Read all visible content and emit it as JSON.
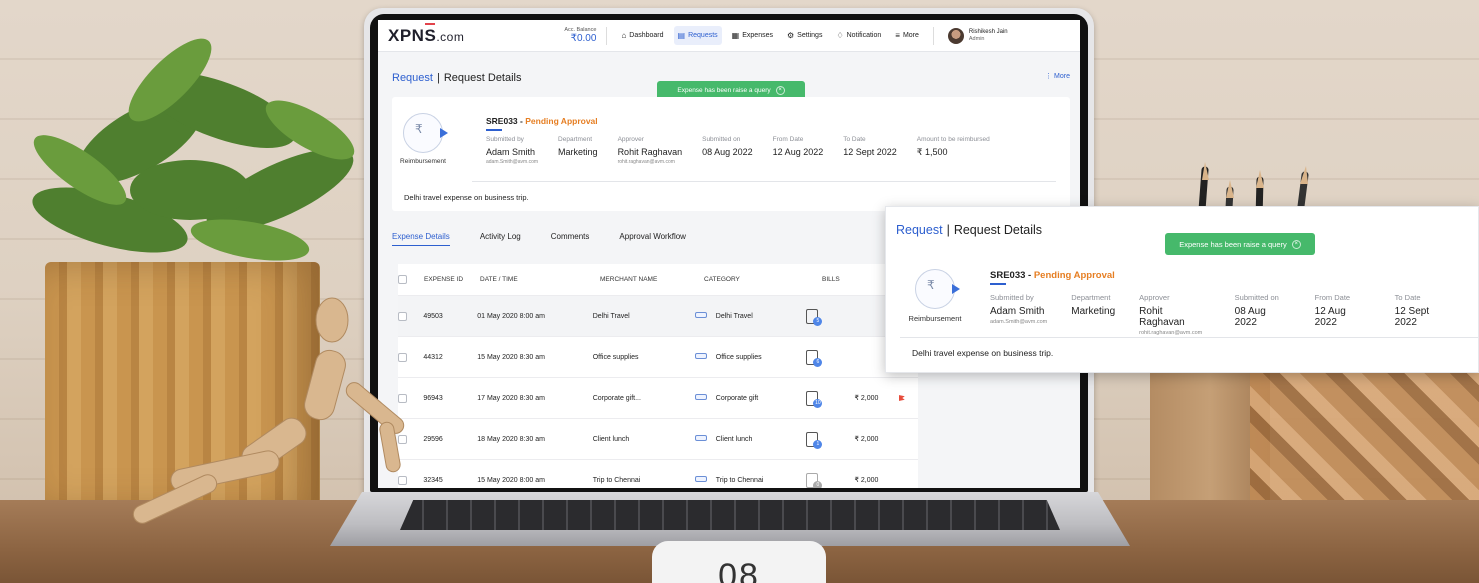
{
  "app": {
    "logo_main": "XPN",
    "logo_over": "S",
    "logo_suffix": ".com",
    "balance_label": "Acc. Balance",
    "balance_value": "₹0.00",
    "nav": [
      {
        "label": "Dashboard",
        "icon": "home-icon"
      },
      {
        "label": "Requests",
        "icon": "requests-icon"
      },
      {
        "label": "Expenses",
        "icon": "expenses-icon"
      },
      {
        "label": "Settings",
        "icon": "gear-icon"
      },
      {
        "label": "Notification",
        "icon": "bell-icon"
      },
      {
        "label": "More",
        "icon": "menu-icon"
      }
    ],
    "user": {
      "name": "Rishikesh Jain",
      "role": "Admin"
    }
  },
  "page": {
    "breadcrumb_root": "Request",
    "breadcrumb_sep": "|",
    "breadcrumb_current": "Request Details",
    "more_label": "More",
    "toast": "Expense has been raise a query"
  },
  "request": {
    "type_label": "Reimbursement",
    "id": "SRE033",
    "id_sep": " - ",
    "status": "Pending Approval",
    "status_color": "#e67e22",
    "submitted_by_label": "Submitted by",
    "submitted_by": "Adam Smith",
    "submitted_by_email": "adam.Smith@avm.com",
    "department_label": "Department",
    "department": "Marketing",
    "approver_label": "Approver",
    "approver": "Rohit Raghavan",
    "approver_email": "rohit.raghavan@avm.com",
    "submitted_on_label": "Submitted on",
    "submitted_on": "08 Aug 2022",
    "from_date_label": "From Date",
    "from_date": "12 Aug 2022",
    "to_date_label": "To Date",
    "to_date": "12 Sept 2022",
    "amount_label": "Amount to be reimbursed",
    "amount": "₹ 1,500",
    "description": "Delhi travel expense on business trip."
  },
  "tabs": [
    "Expense Details",
    "Activity Log",
    "Comments",
    "Approval Workflow"
  ],
  "table": {
    "headers": [
      "EXPENSE ID",
      "DATE / TIME",
      "MERCHANT NAME",
      "CATEGORY",
      "BILLS"
    ],
    "rows": [
      {
        "id": "49503",
        "date": "01 May 2020 8:00 am",
        "merchant": "Delhi Travel",
        "category": "Delhi Travel",
        "bills": "5",
        "amount": "",
        "flag": false
      },
      {
        "id": "44312",
        "date": "15 May 2020 8:30 am",
        "merchant": "Office supplies",
        "category": "Office supplies",
        "bills": "6",
        "amount": "",
        "flag": false
      },
      {
        "id": "96943",
        "date": "17 May 2020 8:30 am",
        "merchant": "Corporate gift...",
        "category": "Corporate gift",
        "bills": "10",
        "amount": "₹ 2,000",
        "flag": true
      },
      {
        "id": "29596",
        "date": "18 May 2020 8:30 am",
        "merchant": "Client lunch",
        "category": "Client lunch",
        "bills": "1",
        "amount": "₹ 2,000",
        "flag": false
      },
      {
        "id": "32345",
        "date": "15 May 2020 8:00 am",
        "merchant": "Trip to Chennai",
        "category": "Trip to Chennai",
        "bills": "0",
        "amount": "₹ 2,000",
        "flag": false
      }
    ]
  },
  "page_number": "08",
  "colors": {
    "accent": "#2d5fcf",
    "success": "#46b96b",
    "flag": "#e74c3c"
  }
}
